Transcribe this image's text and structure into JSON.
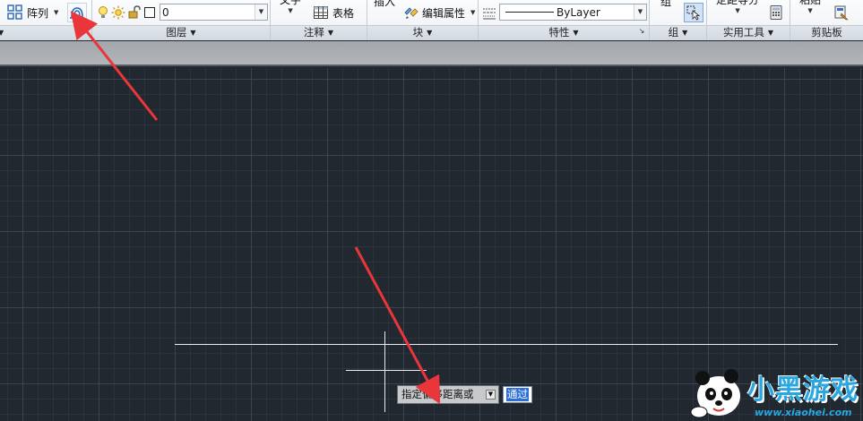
{
  "ribbon": {
    "modify_panel": {
      "array_label": "阵列",
      "title": ""
    },
    "layers_panel": {
      "current_layer": "0",
      "title": "图层"
    },
    "annotation_panel": {
      "text_label": "文字",
      "table_label": "表格",
      "title": "注释"
    },
    "block_panel": {
      "insert_label": "插入",
      "edit_attributes_label": "编辑属性",
      "title": "块"
    },
    "properties_panel": {
      "linetype_value": "ByLayer",
      "title": "特性"
    },
    "groups_panel": {
      "group_label": "组",
      "title": "组"
    },
    "utilities_panel": {
      "measure_label": "定距等分",
      "title": "实用工具"
    },
    "clipboard_panel": {
      "paste_label": "粘贴",
      "title": "剪贴板"
    }
  },
  "command": {
    "prompt_label": "指定偏移距离或",
    "current_value": "通过"
  },
  "watermark": {
    "brand": "小黑游戏",
    "url": "www.xiaohei.com"
  },
  "colors": {
    "canvas_background": "#212830",
    "annotation_arrow": "#e8363a",
    "selection_highlight": "#2e6fd6",
    "ribbon_background": "#f4f6f9"
  }
}
